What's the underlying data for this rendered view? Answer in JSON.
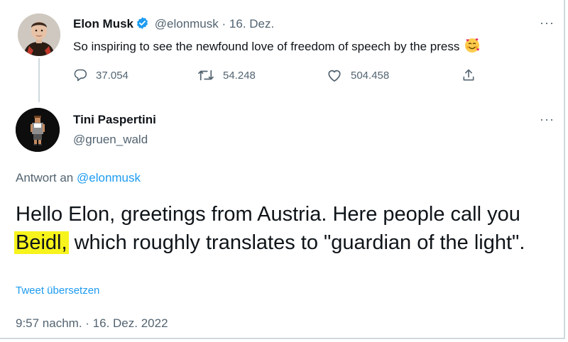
{
  "parent_tweet": {
    "name": "Elon Musk",
    "handle": "@elonmusk",
    "separator": "·",
    "date": "16. Dez.",
    "text": "So inspiring to see the newfound love of freedom of speech by the press",
    "emoji": "smiling-face-with-hearts",
    "more": "···",
    "stats": {
      "replies": "37.054",
      "retweets": "54.248",
      "likes": "504.458"
    }
  },
  "reply_tweet": {
    "name": "Tini Paspertini",
    "handle": "@gruen_wald",
    "more": "···",
    "reply_label": "Antwort an",
    "reply_target": "@elonmusk",
    "text_start": "Hello Elon, greetings from Austria. Here people call you ",
    "text_highlight": "Beidl,",
    "text_end": " which roughly translates to \"guardian of the light\".",
    "highlight_color": "#f7f31c",
    "translate_link": "Tweet übersetzen",
    "timestamp": "9:57 nachm. · 16. Dez. 2022"
  },
  "colors": {
    "link": "#1d9bf0",
    "verified": "#1d9bf0",
    "muted": "#536471",
    "text": "#0f1419"
  }
}
